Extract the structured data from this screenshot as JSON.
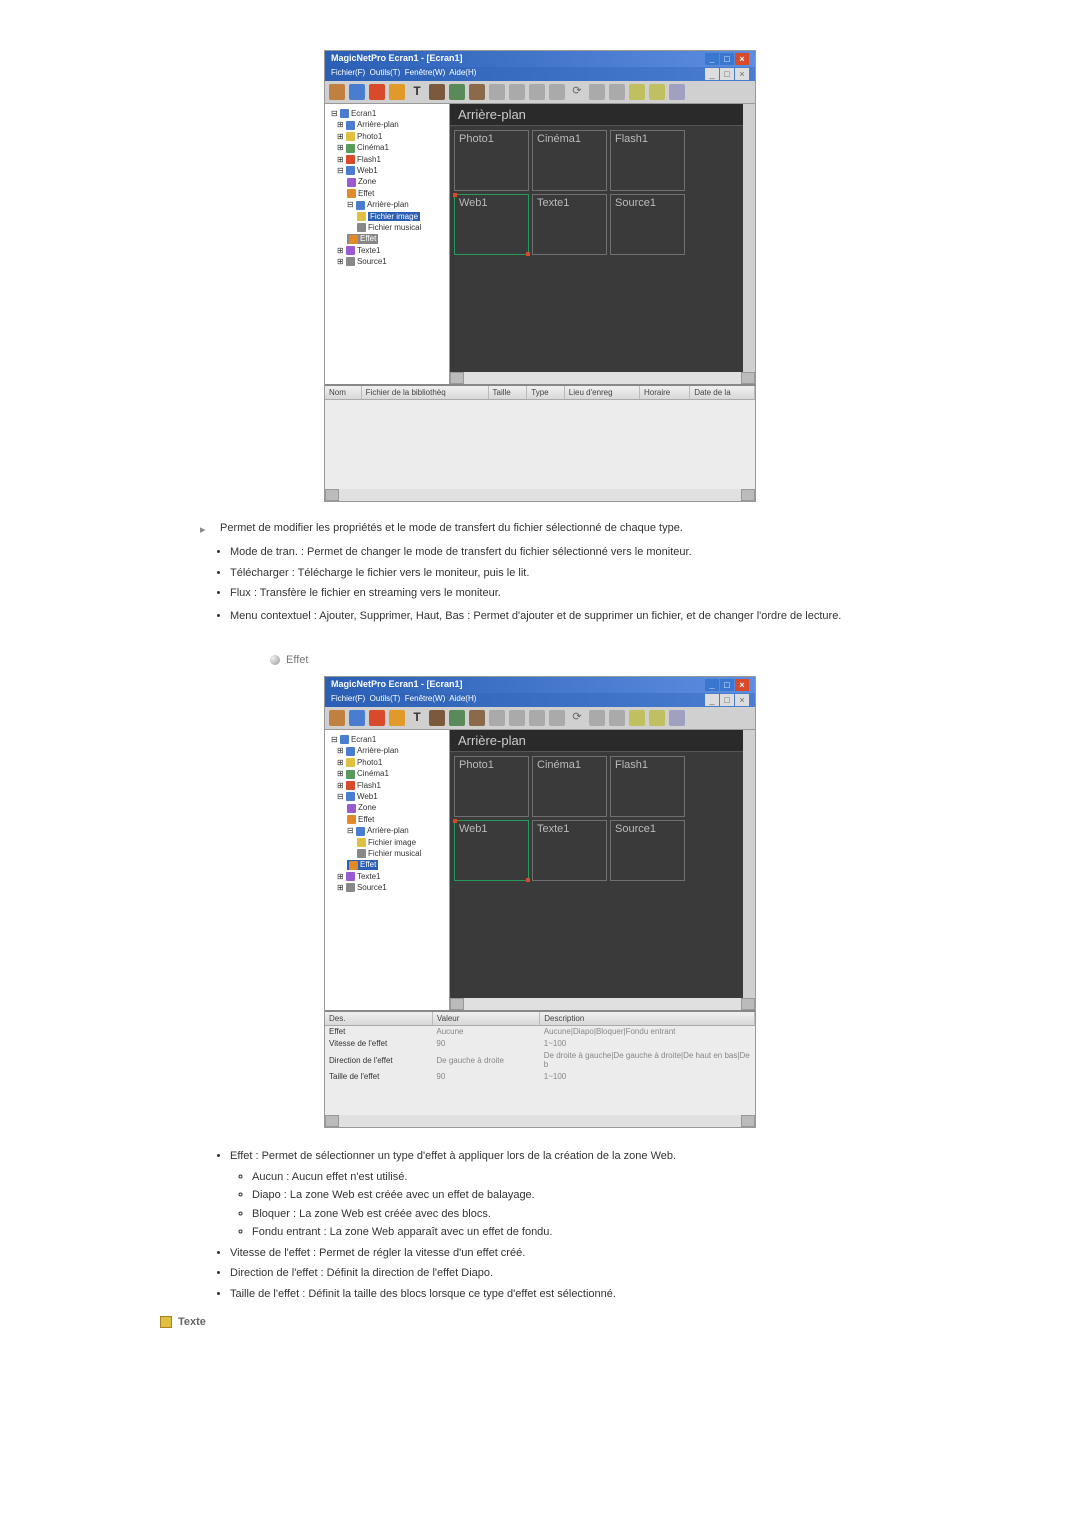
{
  "app": {
    "title": "MagicNetPro Ecran1 - [Ecran1]",
    "menus": [
      "Fichier(F)",
      "Outils(T)",
      "Fenêtre(W)",
      "Aide(H)"
    ]
  },
  "tree": {
    "root": "Ecran1",
    "items": [
      {
        "level": 1,
        "label": "Arrière-plan",
        "icon": "blue"
      },
      {
        "level": 1,
        "label": "Photo1",
        "icon": "yellow"
      },
      {
        "level": 1,
        "label": "Cinéma1",
        "icon": "green"
      },
      {
        "level": 1,
        "label": "Flash1",
        "icon": "red"
      },
      {
        "level": 1,
        "label": "Web1",
        "icon": "blue"
      },
      {
        "level": 2,
        "label": "Zone",
        "icon": "purple"
      },
      {
        "level": 2,
        "label": "Effet",
        "icon": "orange"
      },
      {
        "level": 2,
        "label": "Arrière-plan",
        "icon": "blue"
      },
      {
        "level": 3,
        "label": "Fichier image",
        "icon": "yellow",
        "selected_in": 1
      },
      {
        "level": 3,
        "label": "Fichier musical",
        "icon": "gray"
      },
      {
        "level": 2,
        "label": "Effet",
        "icon": "orange",
        "selected_in": 2
      },
      {
        "level": 1,
        "label": "Texte1",
        "icon": "purple"
      },
      {
        "level": 1,
        "label": "Source1",
        "icon": "gray"
      }
    ]
  },
  "canvas": {
    "title": "Arrière-plan",
    "blocks": [
      "Photo1",
      "Cinéma1",
      "Flash1",
      "Web1",
      "Texte1",
      "Source1"
    ]
  },
  "panel1": {
    "headers": [
      "Nom",
      "Fichier de la bibliothèq",
      "Taille",
      "Type",
      "Lieu d'enreg",
      "Horaire",
      "Date de la"
    ]
  },
  "panel2": {
    "headers": [
      "Des.",
      "Valeur",
      "Description"
    ],
    "rows": [
      {
        "name": "Effet",
        "value": "Aucune",
        "desc": "Aucune|Diapo|Bloquer|Fondu entrant"
      },
      {
        "name": "Vitesse de l'effet",
        "value": "90",
        "desc": "1~100"
      },
      {
        "name": "Direction de l'effet",
        "value": "De gauche à droite",
        "desc": "De droite à gauche|De gauche à droite|De haut en bas|De b"
      },
      {
        "name": "Taille de l'effet",
        "value": "90",
        "desc": "1~100"
      }
    ]
  },
  "doc": {
    "intro": "Permet de modifier les propriétés et le mode de transfert du fichier sélectionné de chaque type.",
    "bullets1": [
      "Mode de tran. : Permet de changer le mode de transfert du fichier sélectionné vers le moniteur.",
      "Télécharger : Télécharge le fichier vers le moniteur, puis le lit.",
      "Flux : Transfère le fichier en streaming vers le moniteur."
    ],
    "bullets1b": [
      "Menu contextuel : Ajouter, Supprimer, Haut, Bas : Permet d'ajouter et de supprimer un fichier, et de changer l'ordre de lecture."
    ],
    "effet_label": "Effet",
    "bullets2": [
      {
        "text": "Effet : Permet de sélectionner un type d'effet à appliquer lors de la création de la zone Web.",
        "sub": [
          "Aucun : Aucun effet n'est utilisé.",
          "Diapo : La zone Web est créée avec un effet de balayage.",
          "Bloquer : La zone Web est créée avec des blocs.",
          "Fondu entrant : La zone Web apparaît avec un effet de fondu."
        ]
      },
      {
        "text": "Vitesse de l'effet : Permet de régler la vitesse d'un effet créé."
      },
      {
        "text": "Direction de l'effet : Définit la direction de l'effet Diapo."
      },
      {
        "text": "Taille de l'effet : Définit la taille des blocs lorsque ce type d'effet est sélectionné."
      }
    ],
    "texte_label": "Texte"
  }
}
